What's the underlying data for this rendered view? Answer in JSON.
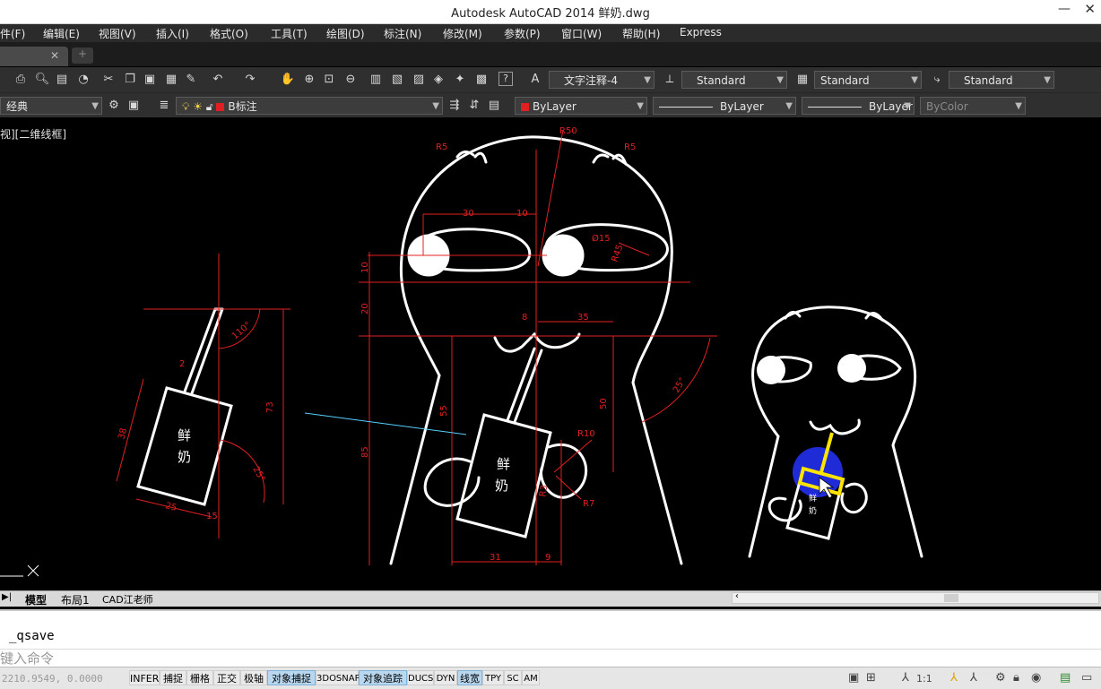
{
  "window": {
    "title": "Autodesk AutoCAD 2014     鲜奶.dwg"
  },
  "menu": [
    "件(F)",
    "编辑(E)",
    "视图(V)",
    "插入(I)",
    "格式(O)",
    "工具(T)",
    "绘图(D)",
    "标注(N)",
    "修改(M)",
    "参数(P)",
    "窗口(W)",
    "帮助(H)",
    "Express"
  ],
  "toolbar1": {
    "text_style": "文字注释-4",
    "dim_style": "Standard",
    "table_style": "Standard",
    "mleader_style": "Standard",
    "icons": [
      "print-icon",
      "preview-icon",
      "plot-icon",
      "publish-icon",
      "cut-icon",
      "copy-icon",
      "paste-icon",
      "match-icon",
      "brush-icon",
      "undo-icon",
      "redo-icon",
      "pan-icon",
      "zoom-icon",
      "zoom-window-icon",
      "zoom-prev-icon",
      "properties-icon",
      "design-center-icon",
      "tool-palettes-icon",
      "sheet-set-icon",
      "markup-icon",
      "calc-icon",
      "help-icon"
    ]
  },
  "toolbar2": {
    "workspace": "经典",
    "layer": "B标注",
    "color": "ByLayer",
    "linetype": "ByLayer",
    "lineweight": "ByLayer",
    "plotstyle": "ByColor",
    "layer_color": "#e02020"
  },
  "viewport": {
    "label": "视][二维线框]"
  },
  "drawing": {
    "fig1": {
      "glyph1": "鲜",
      "glyph2": "奶",
      "dims": [
        "110°",
        "2",
        "38",
        "73",
        "25",
        "15",
        "25°"
      ]
    },
    "fig2": {
      "glyph1": "鲜",
      "glyph2": "奶",
      "dims": [
        "R5",
        "R50",
        "R5",
        "30",
        "10",
        "Ø15",
        "R45",
        "10",
        "20",
        "8",
        "35",
        "55",
        "50",
        "85",
        "R10",
        "R3",
        "R7",
        "31",
        "9",
        "25°"
      ]
    },
    "fig3": {
      "glyph1": "鲜",
      "glyph2": "奶"
    }
  },
  "layout_tabs": [
    "模型",
    "布局1",
    "CAD江老师"
  ],
  "command": {
    "history": "_qsave",
    "placeholder": "键入命令"
  },
  "status": {
    "coords": "2210.9549, 0.0000",
    "buttons": [
      {
        "label": "INFER",
        "on": false
      },
      {
        "label": "捕捉",
        "on": false
      },
      {
        "label": "栅格",
        "on": false
      },
      {
        "label": "正交",
        "on": false
      },
      {
        "label": "极轴",
        "on": false
      },
      {
        "label": "对象捕捉",
        "on": true
      },
      {
        "label": "3DOSNAP",
        "on": false
      },
      {
        "label": "对象追踪",
        "on": true
      },
      {
        "label": "DUCS",
        "on": false
      },
      {
        "label": "DYN",
        "on": false
      },
      {
        "label": "线宽",
        "on": true
      },
      {
        "label": "TPY",
        "on": false
      },
      {
        "label": "SC",
        "on": false
      },
      {
        "label": "AM",
        "on": false
      }
    ],
    "annotation_scale": "1:1"
  }
}
